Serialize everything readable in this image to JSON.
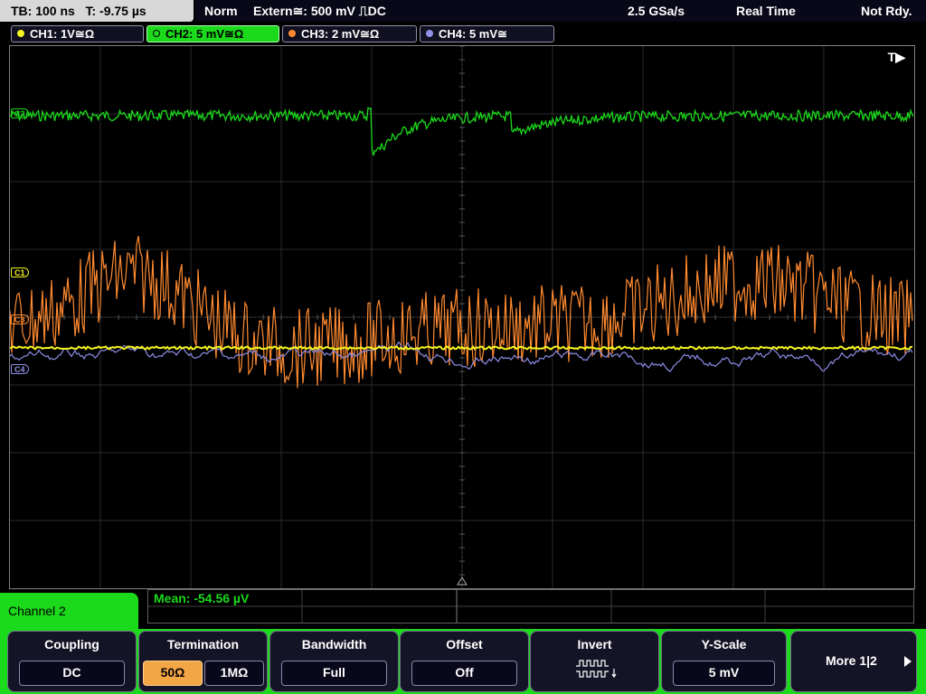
{
  "status": {
    "timebase": "TB: 100 ns",
    "trigger_time": "T: -9.75 µs",
    "mode": "Norm",
    "trigger_source": "Extern≅: 500 mV ⎍DC",
    "sample_rate": "2.5 GSa/s",
    "acq_mode": "Real Time",
    "state": "Not Rdy."
  },
  "channels": [
    {
      "label": "CH1: 1V≅Ω",
      "color": "#f5f520"
    },
    {
      "label": "CH2: 5 mV≅Ω",
      "color": "#1bd91b"
    },
    {
      "label": "CH3: 2 mV≅Ω",
      "color": "#ff8a30"
    },
    {
      "label": "CH4: 5 mV≅",
      "color": "#9090e8"
    }
  ],
  "markers": {
    "c1": "C1",
    "c2": "C2",
    "c3": "C3",
    "c4": "C4",
    "trigger": "T▶"
  },
  "measurement": {
    "label": "Mean: -54.56 µV"
  },
  "menu": {
    "title": "Channel 2",
    "coupling": {
      "title": "Coupling",
      "value": "DC"
    },
    "termination": {
      "title": "Termination",
      "opt1": "50Ω",
      "opt2": "1MΩ"
    },
    "bandwidth": {
      "title": "Bandwidth",
      "value": "Full"
    },
    "offset": {
      "title": "Offset",
      "value": "Off"
    },
    "invert": {
      "title": "Invert"
    },
    "yscale": {
      "title": "Y-Scale",
      "value": "5 mV"
    },
    "more": {
      "title": "More 1|2"
    }
  }
}
